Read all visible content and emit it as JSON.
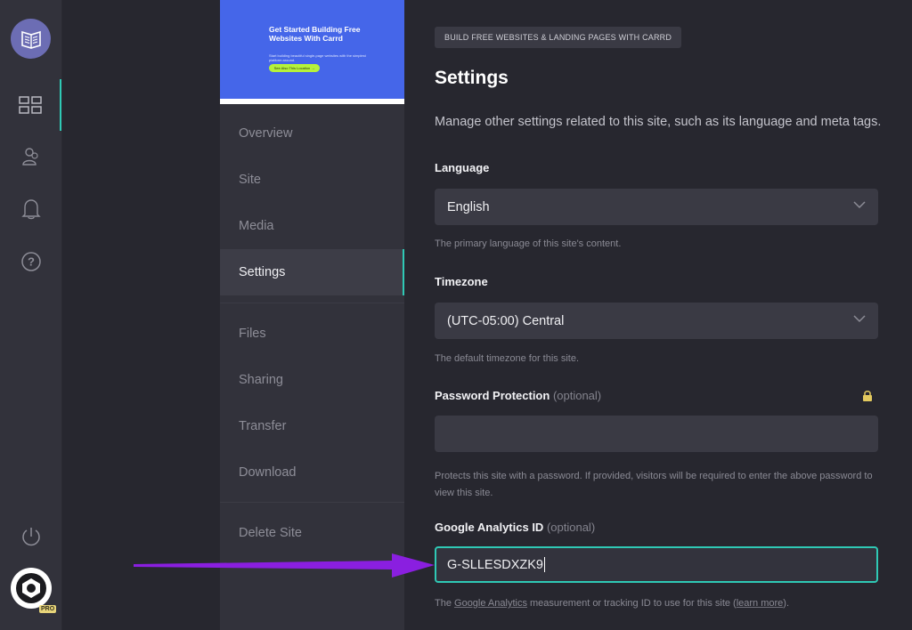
{
  "rail": {
    "icons": [
      "carrd-logo-icon",
      "dashboard-grid-icon",
      "users-icon",
      "bell-icon",
      "help-circle-icon",
      "power-icon"
    ],
    "pro_badge": "PRO"
  },
  "preview": {
    "title": "Get Started Building Free Websites With Carrd",
    "subtitle": "Start building beautiful single-page websites with the simplest platform around.",
    "button": "See Also This Location →"
  },
  "nav": {
    "items": [
      {
        "label": "Overview"
      },
      {
        "label": "Site"
      },
      {
        "label": "Media"
      },
      {
        "label": "Settings"
      },
      {
        "label": "Files"
      },
      {
        "label": "Sharing"
      },
      {
        "label": "Transfer"
      },
      {
        "label": "Download"
      },
      {
        "label": "Delete Site"
      }
    ],
    "active": "Settings"
  },
  "main": {
    "breadcrumb": "BUILD FREE WEBSITES & LANDING PAGES WITH CARRD",
    "title": "Settings",
    "description": "Manage other settings related to this site, such as its language and meta tags.",
    "language": {
      "label": "Language",
      "value": "English",
      "help": "The primary language of this site's content."
    },
    "timezone": {
      "label": "Timezone",
      "value": "(UTC-05:00) Central",
      "help": "The default timezone for this site."
    },
    "password": {
      "label": "Password Protection",
      "optional": "(optional)",
      "value": "",
      "help": "Protects this site with a password. If provided, visitors will be required to enter the above password to view this site."
    },
    "analytics": {
      "label": "Google Analytics ID",
      "optional": "(optional)",
      "value": "G-SLLESDXZK9",
      "help_prefix": "The ",
      "help_link1": "Google Analytics",
      "help_middle": " measurement or tracking ID to use for this site (",
      "help_link2": "learn more",
      "help_suffix": ")."
    }
  },
  "colors": {
    "accent": "#2fc9b5",
    "arrow": "#8a1fe0",
    "preview_bg": "#4566e9"
  }
}
